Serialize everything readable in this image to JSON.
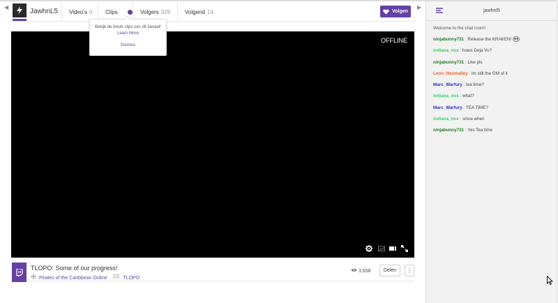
{
  "header": {
    "channel_name": "JawhnL5",
    "tabs": [
      {
        "label": "Video's",
        "count": "0"
      },
      {
        "label": "Clips",
        "count": ""
      },
      {
        "label": "Volgers",
        "count": "329"
      },
      {
        "label": "Volgend",
        "count": "14"
      }
    ],
    "follow_label": "Volgen"
  },
  "tooltip": {
    "text": "Bekijk de beste clips van dit kanaal!",
    "link": "Learn More",
    "dismiss": "Dismiss"
  },
  "player": {
    "status": "OFFLINE"
  },
  "info": {
    "title": "TLOPO: Some of our progress!",
    "game": "Pirates of the Caribbean Online",
    "community": "TLOPO",
    "views": "3,658",
    "share_label": "Delen",
    "more_label": "⋮"
  },
  "chat": {
    "title": "jawhnl5",
    "welcome": "Welcome to the chat room!",
    "messages": [
      {
        "user": "ninjabunny731",
        "color": "#1e7a1e",
        "text": "Release the KRAKEN!"
      },
      {
        "user": "indiana_nox",
        "color": "#2fd65f",
        "text": "hows Deja Vu?"
      },
      {
        "user": "ninjabunny731",
        "color": "#1e7a1e",
        "text": "Like pls"
      },
      {
        "user": "Leon_Hexmalley",
        "color": "#ff5a1f",
        "text": "im still the GM of it"
      },
      {
        "user": "Marc_Warfury",
        "color": "#2b2bd6",
        "text": "tea time?"
      },
      {
        "user": "indiana_nox",
        "color": "#2fd65f",
        "text": "what?"
      },
      {
        "user": "Marc_Warfury",
        "color": "#2b2bd6",
        "text": "TEA TIME?"
      },
      {
        "user": "indiana_nox",
        "color": "#2fd65f",
        "text": "since when"
      },
      {
        "user": "ninjabunny731",
        "color": "#1e7a1e",
        "text": "Yes Tea time"
      }
    ]
  },
  "colors": {
    "accent": "#6441a5",
    "player_bg": "#000000",
    "chat_bg": "#f2f2f2"
  },
  "icons": [
    "left-arrow-icon",
    "right-arrow-icon",
    "channel-logo-icon",
    "heart-icon",
    "settings-icon",
    "theatre-mode-icon",
    "cinema-icon",
    "fullscreen-icon",
    "game-controller-icon",
    "community-icon",
    "eye-icon",
    "chat-menu-icon",
    "kraken-emote-icon",
    "cursor-icon"
  ]
}
